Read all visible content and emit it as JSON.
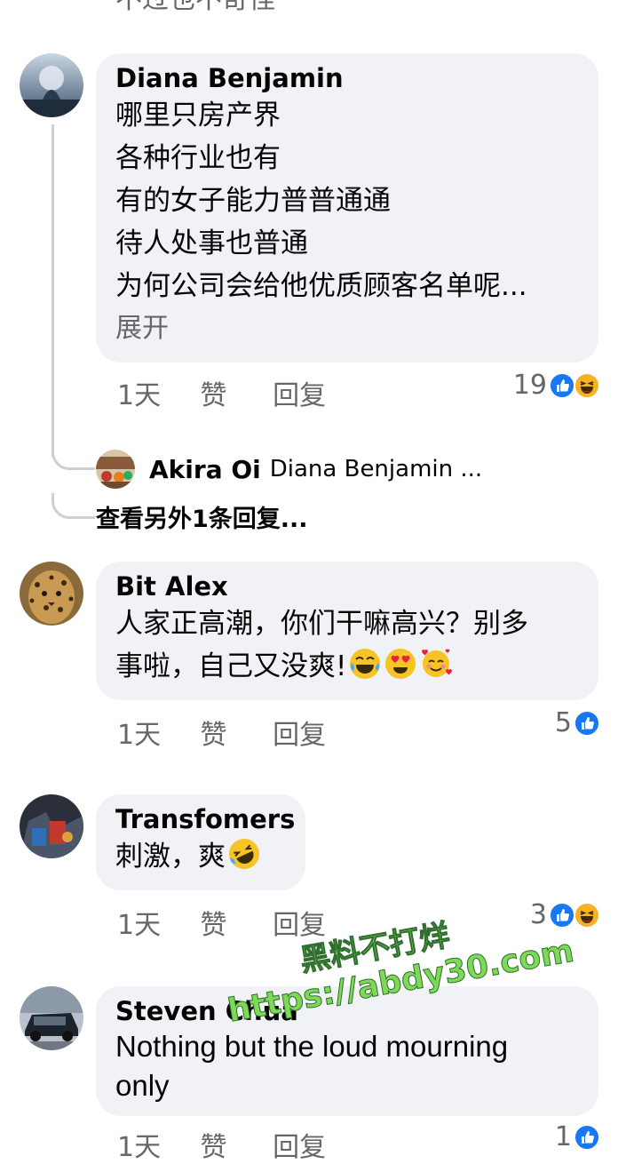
{
  "cut_text": "不过也不奇怪",
  "comments": [
    {
      "author": "Diana Benjamin",
      "lines": [
        "哪里只房产界",
        "各种行业也有",
        "有的女子能力普普通通",
        "待人处事也普通",
        "为何公司会给他优质顾客名单呢..."
      ],
      "expand": "展开",
      "time": "1天",
      "like": "赞",
      "reply": "回复",
      "reaction_count": "19",
      "reactions": [
        "like-icon",
        "haha-icon"
      ]
    },
    {
      "author": "Bit Alex",
      "lines": [
        "人家正高潮，你们干嘛高兴？别多",
        "事啦，自己又没爽!"
      ],
      "emojis": [
        "laughing-tears-emoji",
        "heart-eyes-emoji",
        "smiling-hearts-emoji"
      ],
      "time": "1天",
      "like": "赞",
      "reply": "回复",
      "reaction_count": "5",
      "reactions": [
        "like-icon"
      ]
    },
    {
      "author": "Transfomers",
      "lines": [
        "刺激，爽"
      ],
      "emojis": [
        "rolling-laughing-emoji"
      ],
      "time": "1天",
      "like": "赞",
      "reply": "回复",
      "reaction_count": "3",
      "reactions": [
        "like-icon",
        "haha-icon"
      ]
    },
    {
      "author": "Steven Chua",
      "lines": [
        "Nothing but the loud mourning",
        "only"
      ],
      "time": "1天",
      "like": "赞",
      "reply": "回复",
      "reaction_count": "1",
      "reactions": [
        "like-icon"
      ]
    }
  ],
  "reply_preview": {
    "author": "Akira Oi",
    "text": "Diana Benjamin ..."
  },
  "view_more": "查看另外1条回复...",
  "watermark": {
    "line1": "黑料不打烊",
    "line2": "https://abdy30.com"
  },
  "colors": {
    "bubble": "#f0f2f5",
    "like_blue": "#1877f2",
    "secondary_text": "#65676b"
  }
}
